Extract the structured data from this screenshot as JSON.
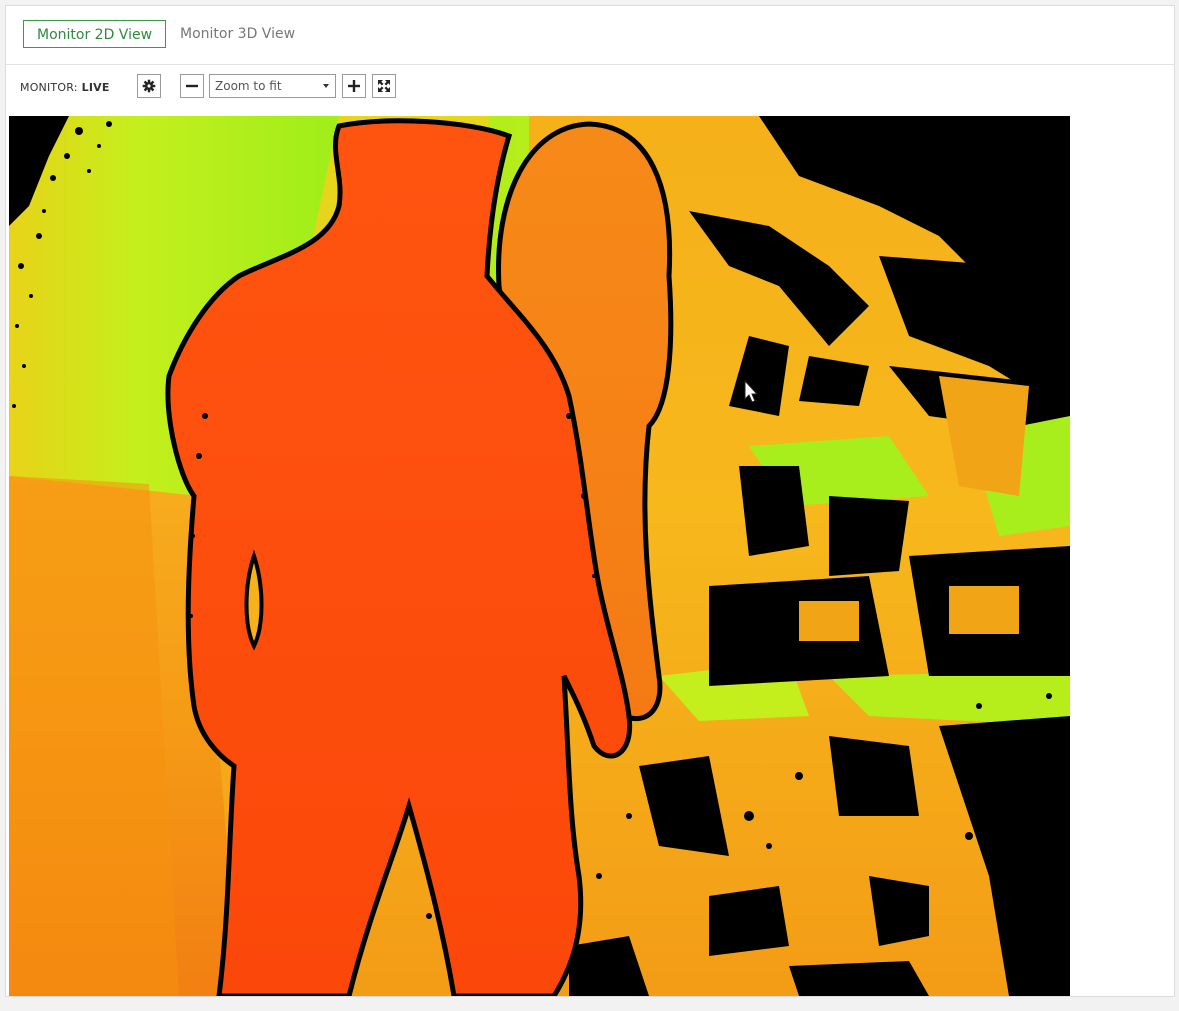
{
  "tabs": [
    {
      "label": "Monitor 2D View",
      "active": true
    },
    {
      "label": "Monitor 3D View",
      "active": false
    }
  ],
  "toolbar": {
    "monitor_label": "MONITOR:",
    "monitor_status": "LIVE",
    "settings_icon": "gear-icon",
    "zoom_out_icon": "minus-icon",
    "zoom_value": "Zoom to fit",
    "zoom_in_icon": "plus-icon",
    "fit_icon": "expand-icon"
  },
  "colors": {
    "accent": "#3a9a4a",
    "depth_near": "#ff4a0a",
    "depth_mid": "#f5a81a",
    "depth_far": "#9aef1a",
    "depth_invalid": "#000000"
  },
  "viewport": {
    "content": "depth-camera-feed",
    "cursor_icon": "mouse-pointer-icon"
  }
}
